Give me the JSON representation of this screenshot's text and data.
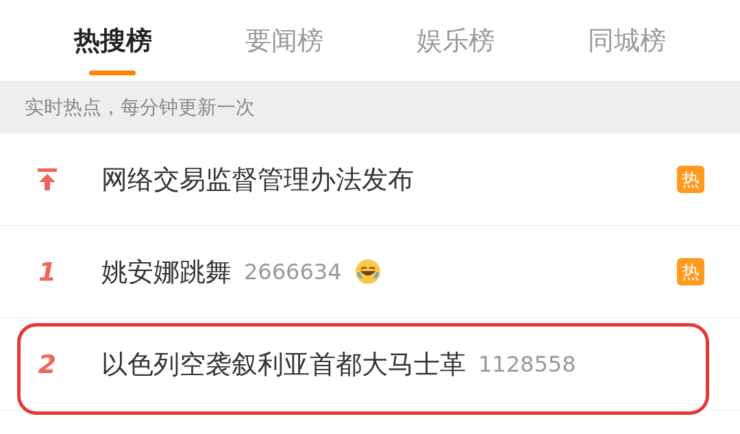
{
  "tabs": [
    {
      "label": "热搜榜",
      "selected": true
    },
    {
      "label": "要闻榜",
      "selected": false
    },
    {
      "label": "娱乐榜",
      "selected": false
    },
    {
      "label": "同城榜",
      "selected": false
    }
  ],
  "notice": "实时热点，每分钟更新一次",
  "rows": [
    {
      "kind": "pinned",
      "title": "网络交易监督管理办法发布",
      "badge": "热"
    },
    {
      "kind": "ranked",
      "rank": "1",
      "title": "姚安娜跳舞",
      "count": "2666634",
      "emoji": true,
      "badge": "热"
    },
    {
      "kind": "ranked",
      "rank": "2",
      "title": "以色列空袭叙利亚首都大马士革",
      "count": "1128558",
      "highlighted": true
    }
  ]
}
